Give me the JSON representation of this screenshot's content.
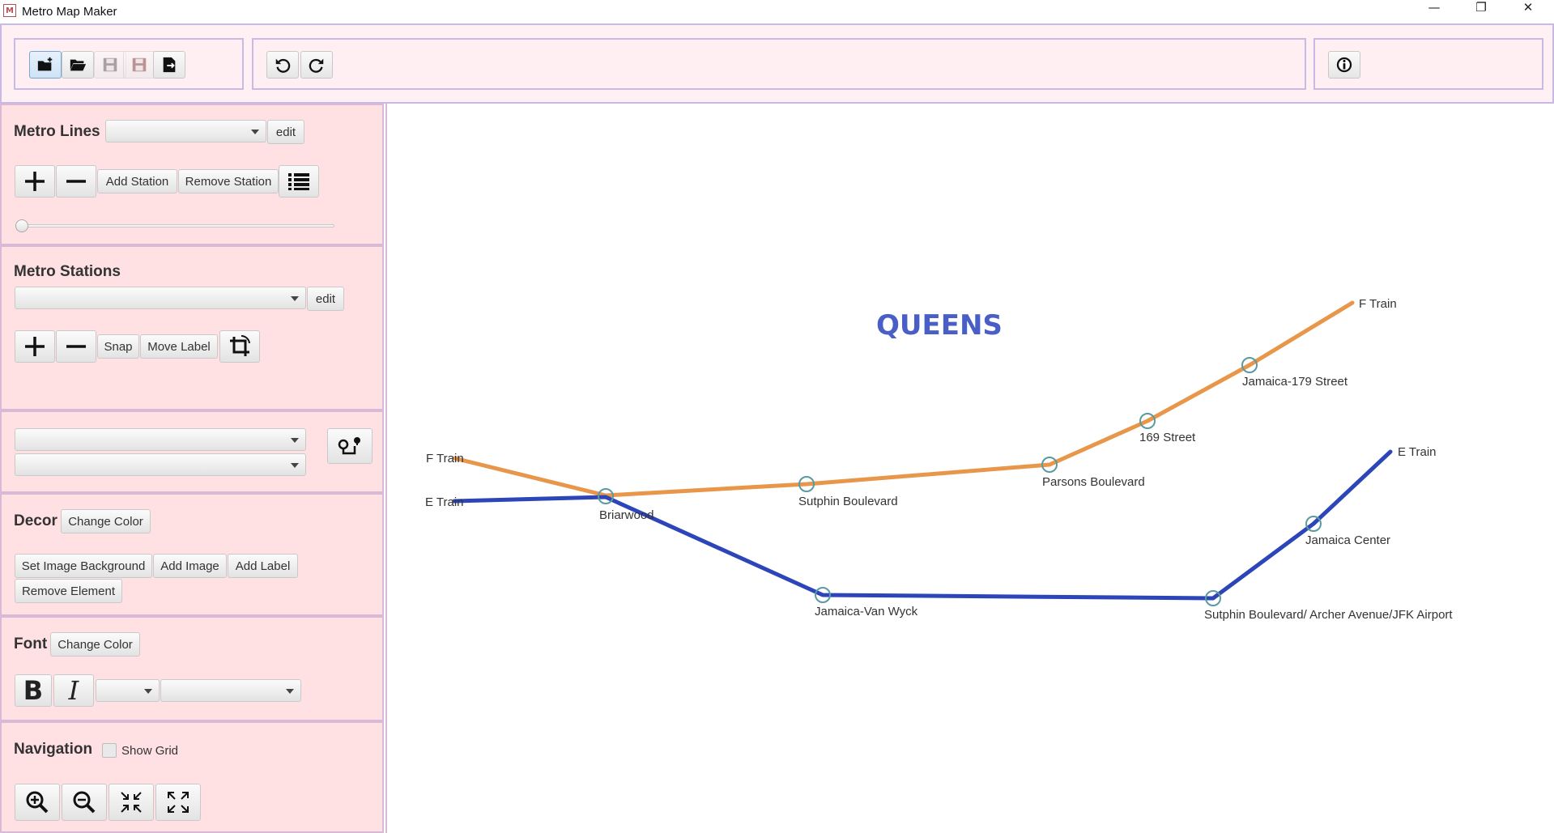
{
  "window": {
    "title": "Metro Map Maker",
    "icon_text": "M",
    "controls": {
      "minimize": "—",
      "restore": "❐",
      "close": "✕"
    }
  },
  "toolbar": {
    "file_buttons": [
      "new-icon",
      "open-icon",
      "save-icon",
      "save-as-icon",
      "export-icon"
    ],
    "edit_buttons": [
      "undo-icon",
      "redo-icon"
    ],
    "info_button": "info-icon"
  },
  "metro_lines": {
    "title": "Metro Lines",
    "selected_line": "",
    "edit_label": "edit",
    "add_station_label": "Add Station",
    "remove_station_label": "Remove Station",
    "thickness": 0
  },
  "metro_stations": {
    "title": "Metro Stations",
    "selected_station": "",
    "edit_label": "edit",
    "snap_label": "Snap",
    "move_label_label": "Move Label",
    "radius": 0
  },
  "route": {
    "from": "",
    "to": ""
  },
  "decor": {
    "title": "Decor",
    "change_color_label": "Change Color",
    "set_image_background_label": "Set Image Background",
    "add_image_label": "Add Image",
    "add_label_label": "Add Label",
    "remove_element_label": "Remove Element"
  },
  "font": {
    "title": "Font",
    "change_color_label": "Change Color",
    "bold_label": "B",
    "italic_label": "I",
    "size": "",
    "family": ""
  },
  "navigation": {
    "title": "Navigation",
    "show_grid_label": "Show Grid",
    "show_grid": false
  },
  "map": {
    "title": "QUEENS",
    "title_color": "#4a5fc6",
    "lines": [
      {
        "name": "F Train",
        "color": "#e8964a",
        "start_label": "F Train",
        "end_label": "F Train",
        "stations": [
          "Briarwood",
          "Sutphin Boulevard",
          "Parsons Boulevard",
          "169 Street",
          "Jamaica-179 Street"
        ]
      },
      {
        "name": "E Train",
        "color": "#2c45b8",
        "start_label": "E Train",
        "end_label": "E Train",
        "stations": [
          "Briarwood",
          "Jamaica-Van Wyck",
          "Sutphin Boulevard/ Archer Avenue/JFK Airport",
          "Jamaica Center"
        ]
      }
    ],
    "station_names": {
      "briarwood": "Briarwood",
      "sutphin": "Sutphin Boulevard",
      "parsons": "Parsons Boulevard",
      "st169": "169 Street",
      "jamaica179": "Jamaica-179 Street",
      "vanwyck": "Jamaica-Van Wyck",
      "archer": "Sutphin Boulevard/ Archer Avenue/JFK Airport",
      "center": "Jamaica Center"
    },
    "station_color": "#5a9aa0"
  }
}
